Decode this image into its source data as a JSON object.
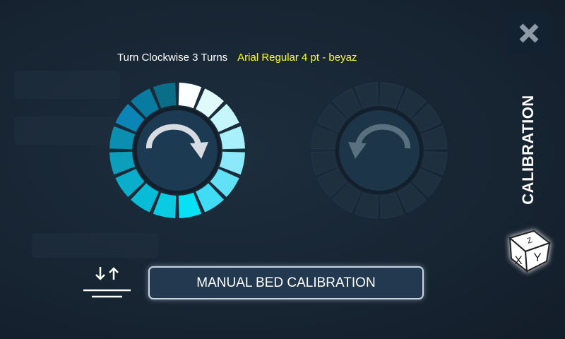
{
  "header": {
    "instruction": "Turn Clockwise 3 Turns",
    "font_note": "Arial Regular 4 pt - beyaz"
  },
  "sidebar": {
    "title": "CALIBRATION",
    "cube_labels": [
      "Z",
      "X",
      "Y"
    ]
  },
  "button": {
    "label": "MANUAL BED CALIBRATION"
  },
  "dials": {
    "clockwise_colors": [
      "#fbffff",
      "#e0f9fa",
      "#c4f6fc",
      "#a8f0fb",
      "#8ce9fa",
      "#62e0f6",
      "#40dbf4",
      "#08e0f4",
      "#0acbe2",
      "#08bcd7",
      "#0aaecb",
      "#0b9fbc",
      "#0a8fb0",
      "#0b85b5",
      "#0a7ba0",
      "#0a6e88"
    ],
    "inactive_color": "#1e2f3e"
  }
}
